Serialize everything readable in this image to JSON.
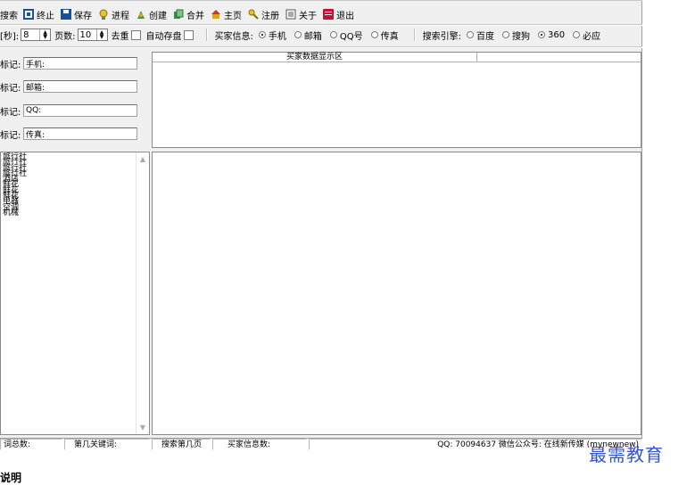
{
  "toolbar": {
    "items": [
      {
        "label": "搜索"
      },
      {
        "label": "终止"
      },
      {
        "label": "保存"
      },
      {
        "label": "进程"
      },
      {
        "label": "创建"
      },
      {
        "label": "合并"
      },
      {
        "label": "主页"
      },
      {
        "label": "注册"
      },
      {
        "label": "关于"
      },
      {
        "label": "退出"
      }
    ]
  },
  "settings": {
    "interval_label": "[秒]:",
    "interval_value": "8",
    "pages_label": "页数:",
    "pages_value": "10",
    "dedupe_label": "去重",
    "autosave_label": "自动存盘",
    "buyer_info_label": "买家信息:",
    "buyer_options": [
      "手机",
      "邮箱",
      "QQ号",
      "传真"
    ],
    "buyer_selected": "手机",
    "engine_label": "搜索引擎:",
    "engine_options": [
      "百度",
      "搜狗",
      "360",
      "必应"
    ],
    "engine_selected": "360"
  },
  "marks": [
    {
      "label": "标记:",
      "value": "手机:"
    },
    {
      "label": "标记:",
      "value": "邮箱:"
    },
    {
      "label": "标记:",
      "value": "QQ:"
    },
    {
      "label": "标记:",
      "value": "传真:"
    }
  ],
  "display_area": {
    "header": "买家数据显示区"
  },
  "keywords": [
    "旅行社",
    "旅行社",
    "旅行社",
    "旅行社",
    "酒店",
    "鲜花",
    "鲜花",
    "鲜花",
    "电器",
    "空调",
    "机械"
  ],
  "statusbar": {
    "cells": [
      "词总数:",
      "第几关键词:",
      "搜索第几页",
      "买家信息数:",
      "QQ: 70094637 微信公众号: 在线新传媒 (mynewnew)"
    ]
  },
  "watermark": "最需教育",
  "below_text": "说明",
  "colors": {
    "window_bg": "#f0f0f0",
    "watermark": "#3355cc",
    "title_icon_red": "#c8102e"
  }
}
